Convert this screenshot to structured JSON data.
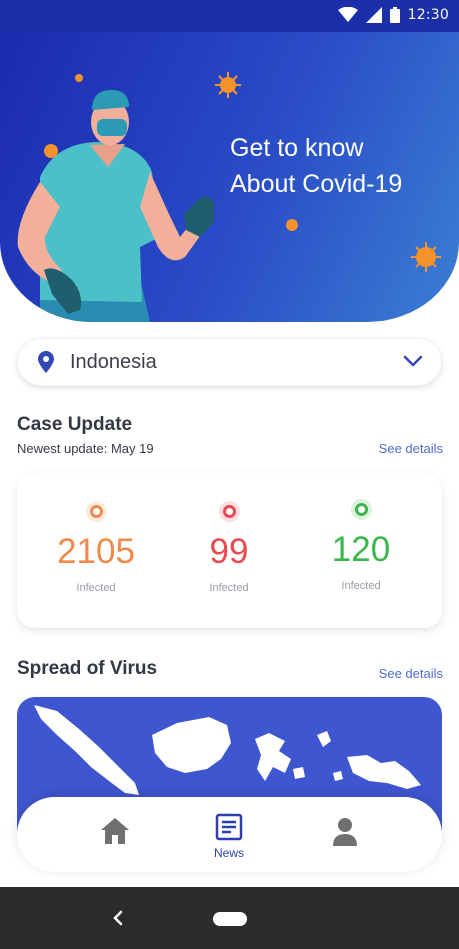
{
  "status_bar": {
    "time": "12:30",
    "icons": [
      "wifi-icon",
      "signal-icon",
      "battery-icon"
    ]
  },
  "hero": {
    "title_line1": "Get to know",
    "title_line2": "About Covid-19"
  },
  "location": {
    "selected": "Indonesia"
  },
  "case_update": {
    "title": "Case Update",
    "newest": "Newest update: May 19",
    "see_details": "See details",
    "stats": [
      {
        "value": "2105",
        "label": "Infected",
        "color": "#f08a4b"
      },
      {
        "value": "99",
        "label": "Infected",
        "color": "#e84a4f"
      },
      {
        "value": "120",
        "label": "Infected",
        "color": "#3cb64a"
      }
    ]
  },
  "spread": {
    "title": "Spread of Virus",
    "see_details": "See details"
  },
  "bottom_nav": {
    "items": [
      {
        "icon": "home-icon",
        "label": ""
      },
      {
        "icon": "news-icon",
        "label": "News"
      },
      {
        "icon": "profile-icon",
        "label": ""
      }
    ]
  },
  "colors": {
    "primary": "#2c3fb0",
    "accent_orange": "#f08a4b",
    "accent_red": "#e84a4f",
    "accent_green": "#3cb64a"
  }
}
